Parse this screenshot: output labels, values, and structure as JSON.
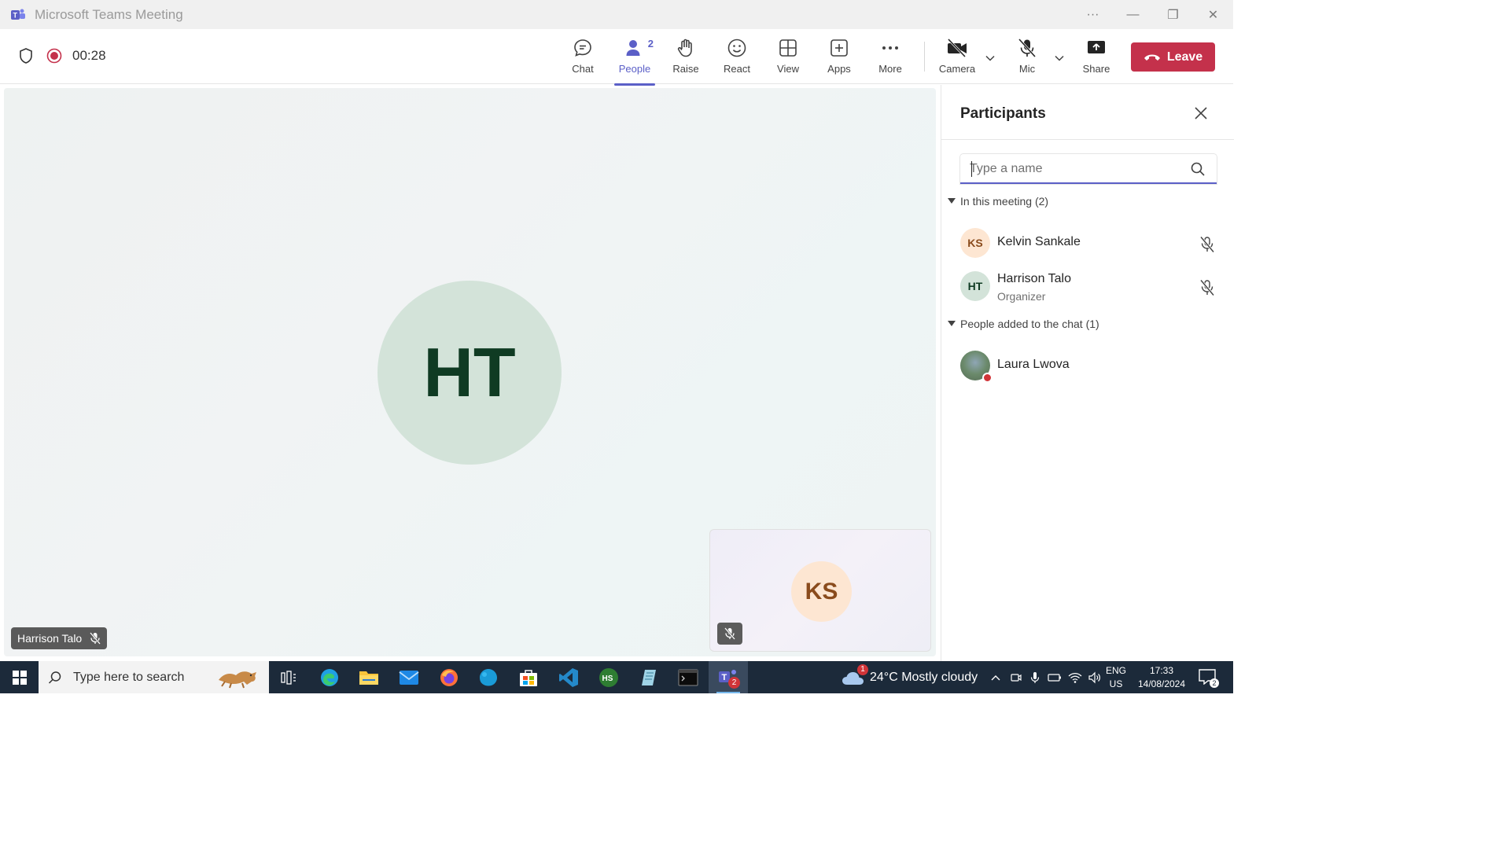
{
  "window": {
    "title": "Microsoft Teams Meeting",
    "controls": {
      "more": "···",
      "minimize": "—",
      "restore": "❐",
      "close": "✕"
    }
  },
  "toolbar": {
    "timer": "00:28",
    "people_count": "2",
    "buttons": {
      "chat": "Chat",
      "people": "People",
      "raise": "Raise",
      "react": "React",
      "view": "View",
      "apps": "Apps",
      "more": "More",
      "camera": "Camera",
      "mic": "Mic",
      "share": "Share"
    },
    "leave": "Leave",
    "accent_color": "#5b5fc7",
    "leave_color": "#c4314b"
  },
  "stage": {
    "main_initials": "HT",
    "main_name": "Harrison Talo",
    "self_initials": "KS"
  },
  "participants": {
    "title": "Participants",
    "search_placeholder": "Type a name",
    "in_meeting_label": "In this meeting (2)",
    "added_label": "People added to the chat (1)",
    "in_meeting": [
      {
        "initials": "KS",
        "name": "Kelvin Sankale",
        "role": ""
      },
      {
        "initials": "HT",
        "name": "Harrison Talo",
        "role": "Organizer"
      }
    ],
    "added": [
      {
        "name": "Laura Lwova"
      }
    ]
  },
  "taskbar": {
    "search_text": "Type here to search",
    "weather_badge": "1",
    "weather": "24°C  Mostly cloudy",
    "lang_top": "ENG",
    "lang_bottom": "US",
    "time": "17:33",
    "date": "14/08/2024",
    "teams_badge": "2",
    "notif_count": "2",
    "vscode_label": "HS"
  }
}
